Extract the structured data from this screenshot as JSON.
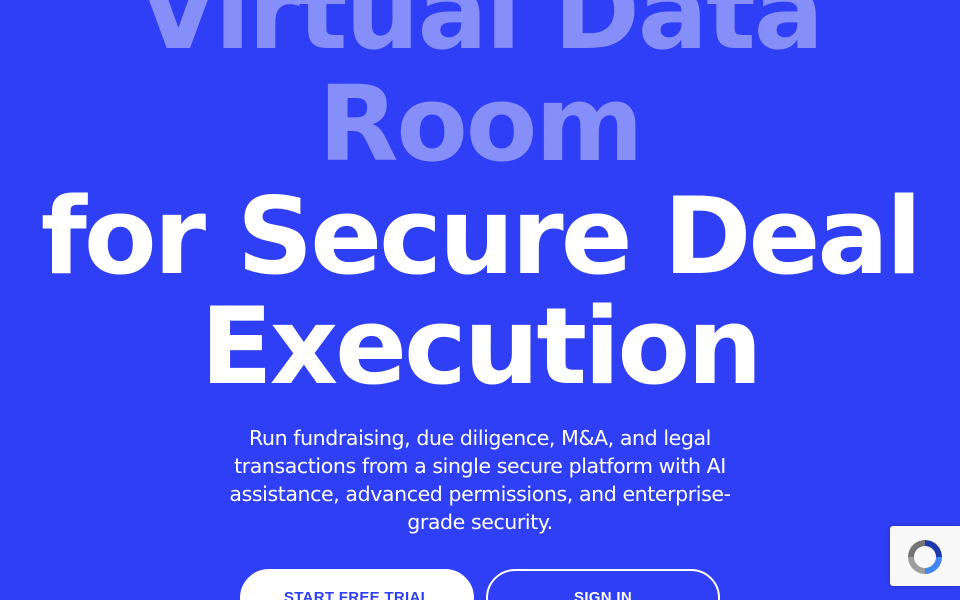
{
  "hero": {
    "headline_line_1": "Virtual Data",
    "headline_line_2": "Room",
    "headline_line_3": "for Secure Deal",
    "headline_line_4": "Execution",
    "subtext": "Run fundraising, due diligence, M&A, and legal transactions from a single secure platform with AI assistance, advanced permissions, and enterprise-grade security."
  },
  "cta": {
    "primary_label": "START FREE TRIAL",
    "secondary_label": "SIGN IN"
  },
  "recaptcha": {
    "icon": "recaptcha-icon"
  },
  "colors": {
    "background": "#2f3ff5",
    "text": "#ffffff",
    "primary_button_text": "#2f3ff5"
  }
}
